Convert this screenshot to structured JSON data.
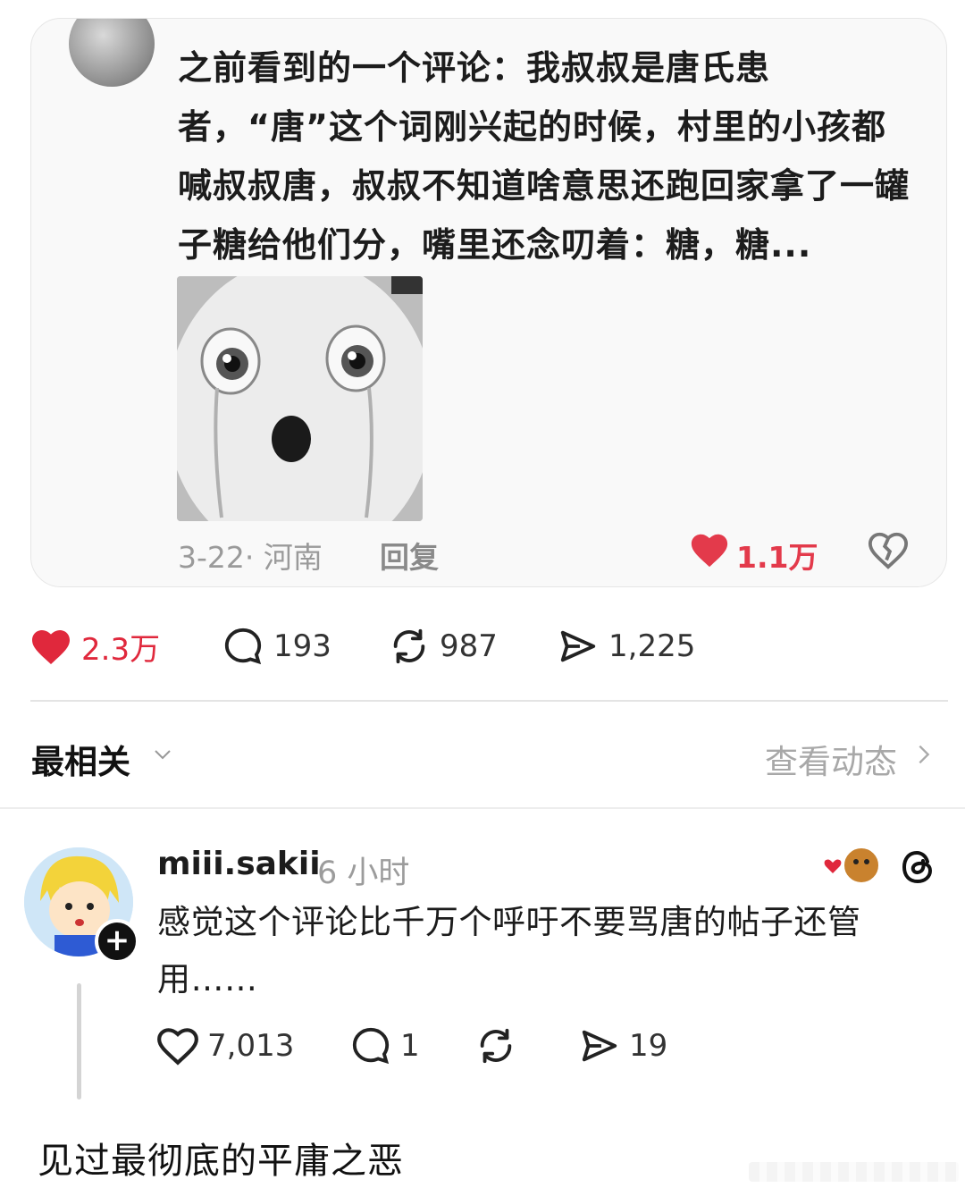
{
  "quoted_comment": {
    "text": "之前看到的一个评论：我叔叔是唐氏患者，“唐”这个词刚兴起的时候，村里的小孩都喊叔叔唐，叔叔不知道啥意思还跑回家拿了一罐子糖给他们分，嘴里还念叨着：糖，糖...",
    "date_location": "3-22· 河南",
    "reply_label": "回复",
    "like_count": "1.1万"
  },
  "post_stats": {
    "likes": "2.3万",
    "comments": "193",
    "reposts": "987",
    "shares": "1,225"
  },
  "sort_bar": {
    "sort_label": "最相关",
    "activity_label": "查看动态"
  },
  "reply": {
    "username": "miii.sakii",
    "time": "6 小时",
    "text": "感觉这个评论比千万个呼吁不要骂唐的帖子还管用……",
    "likes": "7,013",
    "comments": "1",
    "shares": "19"
  },
  "caption": "见过最彻底的平庸之恶",
  "colors": {
    "like_red": "#e0283c",
    "muted_gray": "#9a9a9a",
    "card_bg": "#f9f9f9"
  }
}
